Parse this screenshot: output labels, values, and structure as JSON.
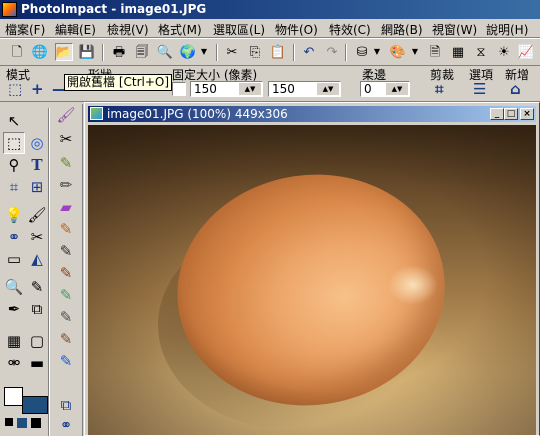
{
  "app": {
    "title": "PhotoImpact - image01.JPG"
  },
  "menu": [
    "檔案(F)",
    "編輯(E)",
    "檢視(V)",
    "格式(M)",
    "選取區(L)",
    "物件(O)",
    "特效(C)",
    "網路(B)",
    "視窗(W)",
    "說明(H)"
  ],
  "toolbar": {
    "tooltip": "開啟舊檔 [Ctrl+O]",
    "buttons": [
      "new-file",
      "open-web",
      "open-file",
      "save",
      "print",
      "print-preview",
      "scan",
      "browser",
      "cut",
      "copy",
      "paste",
      "undo",
      "redo",
      "stamp",
      "visual-palette",
      "document",
      "color-chart",
      "transform",
      "light",
      "graph"
    ]
  },
  "attributes": {
    "mode_label": "模式",
    "shape_label": "形狀",
    "fixed_size_label": "固定大小 (像素)",
    "width_value": "150",
    "height_value": "150",
    "soft_edge_label": "柔邊",
    "soft_edge_value": "0",
    "crop_label": "剪裁",
    "options_label": "選項",
    "new_label": "新增"
  },
  "document": {
    "title": "image01.JPG (100%) 449x306"
  },
  "colors": {
    "title_active": "#0a246a",
    "title_gradient_end": "#3a6ea5",
    "face": "#d4d0c8",
    "foreground_swatch": "#ffffff",
    "background_swatch": "#1f4f7f"
  }
}
